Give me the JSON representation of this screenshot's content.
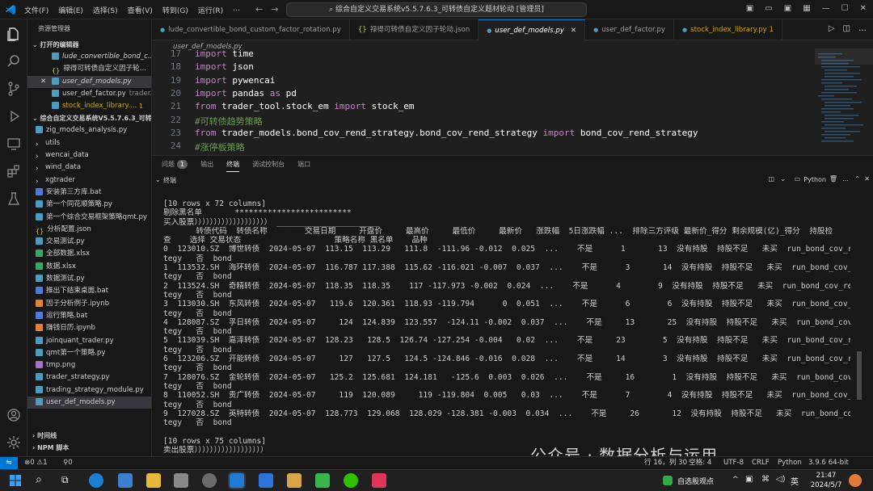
{
  "titlebar": {
    "menu": [
      "文件(F)",
      "编辑(E)",
      "选择(S)",
      "查看(V)",
      "转到(G)",
      "运行(R)",
      "..."
    ],
    "search_text": "综合自定义交易系统v5.5.7.6.3_可转债自定义题材轮动 [管理员]"
  },
  "sidebar": {
    "title": "资源管理器",
    "open_editors_title": "打开的编辑器",
    "open_editors": [
      {
        "label": "lude_convertible_bond_c...",
        "icon_color": "#519aba",
        "badge": "",
        "modified": false,
        "deco": "",
        "italic": true
      },
      {
        "label": "禄得可转债自定义因子轮...",
        "icon_color": "#cbcb41",
        "badge": "",
        "modified": false,
        "deco": "{}",
        "italic": false
      },
      {
        "label": "user_def_models.py",
        "icon_color": "#519aba",
        "badge": "",
        "modified": true,
        "deco": "",
        "italic": true
      },
      {
        "label": "user_def_factor.py",
        "icon_color": "#519aba",
        "badge": "",
        "modified": false,
        "deco": "",
        "italic": false,
        "suffix": "trader..."
      },
      {
        "label": "stock_index_library....",
        "icon_color": "#519aba",
        "badge": "1",
        "modified": false,
        "deco": "",
        "italic": false
      }
    ],
    "project_title": "综合自定义交易系统V5.5.7.6.3_可转...",
    "files": [
      {
        "label": "zig_models_analysis.py",
        "type": "py"
      },
      {
        "label": "utils",
        "type": "folder"
      },
      {
        "label": "wencai_data",
        "type": "folder"
      },
      {
        "label": "wind_data",
        "type": "folder"
      },
      {
        "label": "xgtrader",
        "type": "folder"
      },
      {
        "label": "安装第三方库.bat",
        "type": "bat"
      },
      {
        "label": "第一个同花顺策略.py",
        "type": "py"
      },
      {
        "label": "第一个综合交易框架策略qmt.py",
        "type": "py"
      },
      {
        "label": "分析配置.json",
        "type": "json"
      },
      {
        "label": "交易测试.py",
        "type": "py"
      },
      {
        "label": "全部数据.xlsx",
        "type": "xlsx"
      },
      {
        "label": "数据.xlsx",
        "type": "xlsx"
      },
      {
        "label": "数据测试.py",
        "type": "py"
      },
      {
        "label": "推出下结束桌面.bat",
        "type": "bat"
      },
      {
        "label": "因子分析例子.ipynb",
        "type": "ipynb"
      },
      {
        "label": "运行策略.bat",
        "type": "bat"
      },
      {
        "label": "赚钱日历.ipynb",
        "type": "ipynb"
      },
      {
        "label": "joinquant_trader.py",
        "type": "py"
      },
      {
        "label": "qmt第一个策略.py",
        "type": "py"
      },
      {
        "label": "tmp.png",
        "type": "png"
      },
      {
        "label": "trader_strategy.py",
        "type": "py"
      },
      {
        "label": "trading_strategy_module.py",
        "type": "py"
      },
      {
        "label": "user_def_models.py",
        "type": "py",
        "active": true
      }
    ],
    "timeline": "时间线",
    "npm": "NPM 脚本"
  },
  "tabs": [
    {
      "label": "lude_convertible_bond_custom_factor_rotation.py",
      "icon": "py",
      "active": false,
      "badge": ""
    },
    {
      "label": "禄得可转债自定义因子轮动.json",
      "icon": "json",
      "active": false,
      "badge": ""
    },
    {
      "label": "user_def_models.py",
      "icon": "py",
      "active": true,
      "badge": ""
    },
    {
      "label": "user_def_factor.py",
      "icon": "py",
      "active": false,
      "badge": ""
    },
    {
      "label": "stock_index_library.py 1",
      "icon": "py",
      "active": false,
      "badge": ""
    }
  ],
  "breadcrumb": "user_def_models.py",
  "editor": {
    "lines": [
      {
        "n": "17",
        "parts": [
          [
            "kw",
            "import"
          ],
          [
            "mod",
            " time"
          ]
        ]
      },
      {
        "n": "18",
        "parts": [
          [
            "kw",
            "import"
          ],
          [
            "mod",
            " json"
          ]
        ]
      },
      {
        "n": "19",
        "parts": [
          [
            "kw",
            "import"
          ],
          [
            "mod",
            " pywencai"
          ]
        ]
      },
      {
        "n": "20",
        "parts": [
          [
            "kw",
            "import"
          ],
          [
            "mod",
            " pandas "
          ],
          [
            "kw",
            "as"
          ],
          [
            "mod",
            " pd"
          ]
        ]
      },
      {
        "n": "21",
        "parts": [
          [
            "kw",
            "from"
          ],
          [
            "mod",
            " trader_tool.stock_em "
          ],
          [
            "kw",
            "import"
          ],
          [
            "mod",
            " stock_em"
          ]
        ]
      },
      {
        "n": "22",
        "parts": [
          [
            "cm",
            "#可转债趋势策略"
          ]
        ]
      },
      {
        "n": "23",
        "parts": [
          [
            "kw",
            "from"
          ],
          [
            "mod",
            " trader_models.bond_cov_rend_strategy.bond_cov_rend_strategy "
          ],
          [
            "kw",
            "import"
          ],
          [
            "mod",
            " bond_cov_rend_strategy"
          ]
        ]
      },
      {
        "n": "24",
        "parts": [
          [
            "cm",
            "#涨停板策略"
          ]
        ]
      }
    ]
  },
  "panel": {
    "tabs": [
      "问题",
      "输出",
      "终端",
      "调试控制台",
      "端口"
    ],
    "problems_count": "1",
    "active_tab": "终端",
    "terminal_label": "终端",
    "shell_label": "Python",
    "lines": [
      "[10 rows x 72 columns]",
      "剔除黑名单       *************************",
      "买入股票））））））））））））））））））） ______________________",
      "       转债代码  转债名称        交易日期     开盘价     最高价     最低价     最新价   涨跌幅  5日涨跌幅 ...  排除三方评级 最新价_得分 剩余规模(亿)_得分  持股检",
      "查    选择 交易状态                    策略名称 黑名单    品种",
      "0  123010.SZ  博世转债  2024-05-07  113.15  113.29   111.8  -111.96 -0.012  0.025  ...    不是      1       13  没有持股  持股不足   未买  run_bond_cov_rend_stra",
      "tegy   否  bond",
      "1  113532.SH  海环转债  2024-05-07  116.787 117.388  115.62 -116.021 -0.007  0.037  ...    不是      3       14  没有持股  持股不足   未买  run_bond_cov_rend_stra",
      "tegy   否  bond",
      "2  113524.SH  奇精转债  2024-05-07  118.35  118.35    117 -117.973 -0.002  0.024  ...    不是      4        9  没有持股  持股不足   未买  run_bond_cov_rend_stra",
      "tegy   否  bond",
      "3  113030.SH  东风转债  2024-05-07   119.6  120.361  118.93 -119.794      0  0.051  ...    不是      6        6  没有持股  持股不足   未买  run_bond_cov_rend_stra",
      "tegy   否  bond",
      "4  128087.SZ  孚日转债  2024-05-07     124  124.839  123.557  -124.11 -0.002  0.037  ...    不是     13       25  没有持股  持股不足   未买  run_bond_cov_rend_stra",
      "tegy   否  bond",
      "5  113039.SH  嘉泽转债  2024-05-07  128.23   128.5  126.74 -127.254 -0.004   0.02  ...    不是     23        5  没有持股  持股不足   未买  run_bond_cov_rend_stra",
      "tegy   否  bond",
      "6  123206.SZ  开能转债  2024-05-07     127   127.5   124.5 -124.846 -0.016  0.028  ...    不是     14        3  没有持股  持股不足   未买  run_bond_cov_rend_stra",
      "tegy   否  bond",
      "7  128076.SZ  金轮转债  2024-05-07   125.2  125.681  124.181   -125.6  0.003  0.026  ...    不是     16        1  没有持股  持股不足   未买  run_bond_cov_rend_stra",
      "tegy   否  bond",
      "8  110052.SH  贵广转债  2024-05-07     119  120.089     119 -119.804  0.005   0.03  ...    不是      7        4  没有持股  持股不足   未买  run_bond_cov_rend_stra",
      "tegy   否  bond",
      "9  127028.SZ  英特转债  2024-05-07  128.773  129.068  128.029 -128.381 -0.003  0.034  ...    不是     26       12  没有持股  持股不足   未买  run_bond_cov_rend_stra",
      "tegy   否  bond",
      "",
      "[10 rows x 75 columns]",
      "卖出股票））））））））））））））））））"
    ]
  },
  "statusbar": {
    "errors": "⊗0 ⚠1",
    "ports": "⚲0",
    "position": "行 16，列 30",
    "spaces": "空格: 4",
    "encoding": "UTF-8",
    "eol": "CRLF",
    "lang": "Python",
    "version": "3.9.6 64-bit"
  },
  "watermark": "公众号 · 数据分析与运用",
  "taskbar": {
    "weather": "自选股观点",
    "clock_time": "21:47",
    "clock_date": "2024/5/7",
    "ime": "英"
  }
}
